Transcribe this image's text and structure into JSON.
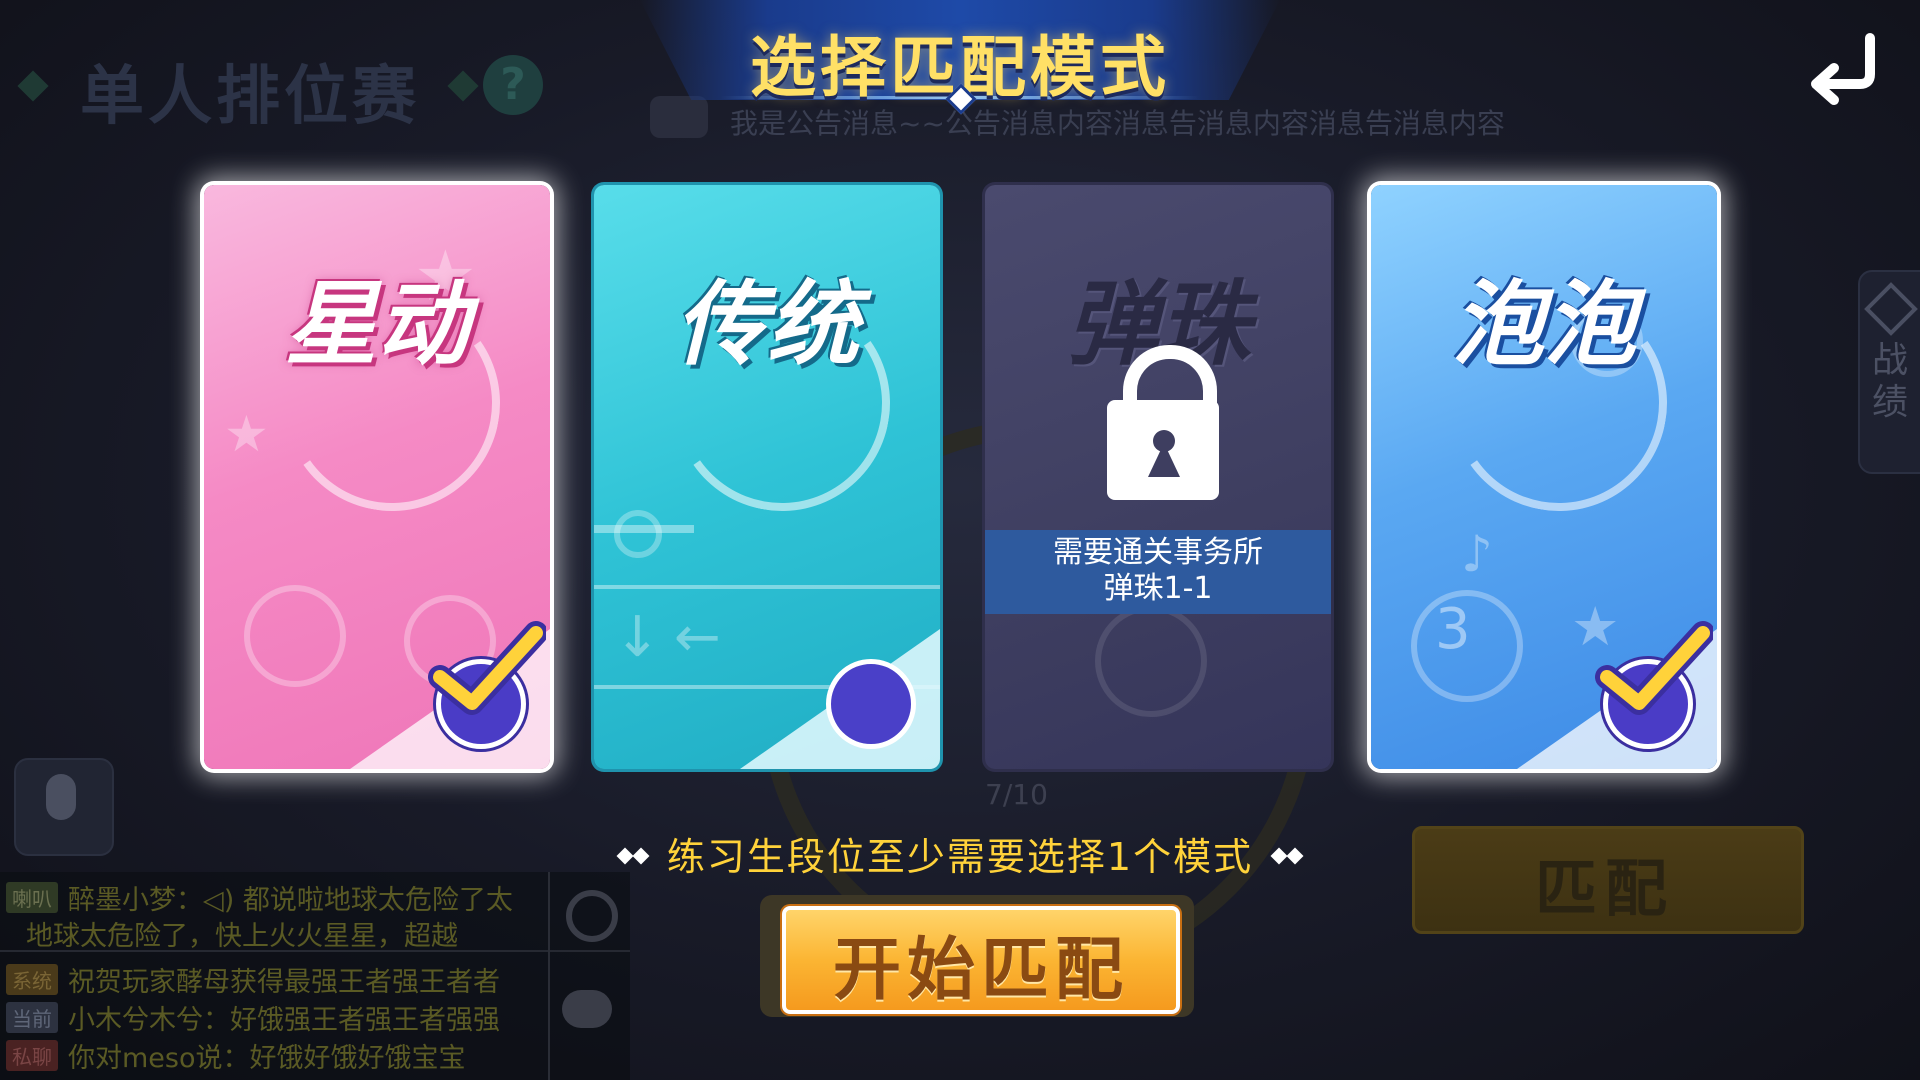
{
  "header": {
    "title": "选择匹配模式"
  },
  "background": {
    "mode_title": "单人排位赛",
    "help": "?",
    "announcement": "我是公告消息~~公告消息内容消息告消息内容消息告消息内容",
    "progress": "7/10",
    "side_tab_label": "战绩",
    "match_button": "匹配"
  },
  "cards": [
    {
      "name": "星动",
      "selected": true
    },
    {
      "name": "传统",
      "selected": false
    },
    {
      "name": "弹珠",
      "locked": true,
      "lock_text_line1": "需要通关事务所",
      "lock_text_line2": "弹珠1-1"
    },
    {
      "name": "泡泡",
      "selected": true
    }
  ],
  "hint": "练习生段位至少需要选择1个模式",
  "start_button": "开始匹配",
  "chat": [
    {
      "tag": "喇叭",
      "text": "醉墨小梦：◁) 都说啦地球太危险了太"
    },
    {
      "tag": "",
      "text": "地球太危险了，快上火火星星，超越"
    },
    {
      "tag": "系统",
      "text": "祝贺玩家酵母获得最强王者强王者者"
    },
    {
      "tag": "当前",
      "text": "小木兮木兮：好饿强王者强王者强强"
    },
    {
      "tag": "私聊",
      "text": "你对meso说：好饿好饿好饿宝宝"
    }
  ],
  "colors": {
    "accent_yellow": "#ffd23a",
    "title_yellow": "#ffe066",
    "check_purple": "#4a3cc6",
    "pink_card": "#f58ac5",
    "cyan_card": "#2fc3d6",
    "locked_card": "#3e3e60",
    "blue_card": "#5aa8f2"
  }
}
